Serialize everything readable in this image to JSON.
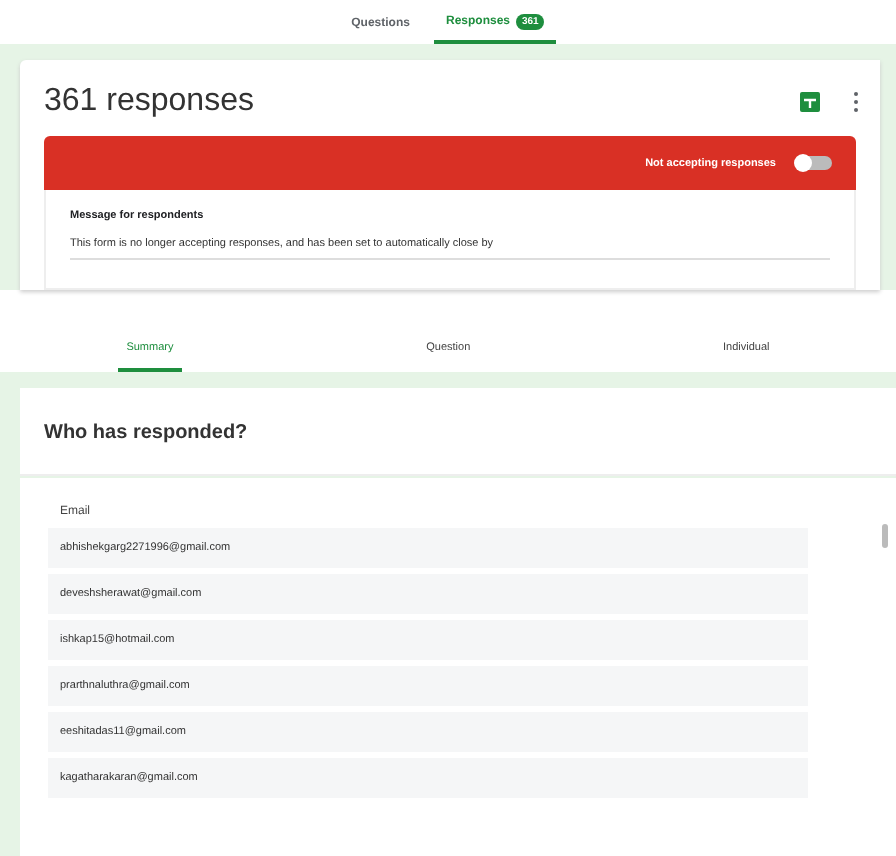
{
  "top_tabs": [
    {
      "label": "Questions",
      "selected": false
    },
    {
      "label": "Responses",
      "selected": true,
      "badge": "361"
    }
  ],
  "title": "361 responses",
  "accepting": {
    "label": "Not accepting responses",
    "on": false
  },
  "message": {
    "label": "Message for respondents",
    "value": "This form is no longer accepting responses, and has been set to automatically close by"
  },
  "view_tabs": [
    {
      "label": "Summary",
      "selected": true
    },
    {
      "label": "Question",
      "selected": false
    },
    {
      "label": "Individual",
      "selected": false
    }
  ],
  "section_title": "Who has responded?",
  "table": {
    "column": "Email",
    "rows": [
      "abhishekgarg2271996@gmail.com",
      "deveshsherawat@gmail.com",
      "ishkap15@hotmail.com",
      "prarthnaluthra@gmail.com",
      "eeshitadas11@gmail.com",
      "kagatharakaran@gmail.com"
    ]
  }
}
